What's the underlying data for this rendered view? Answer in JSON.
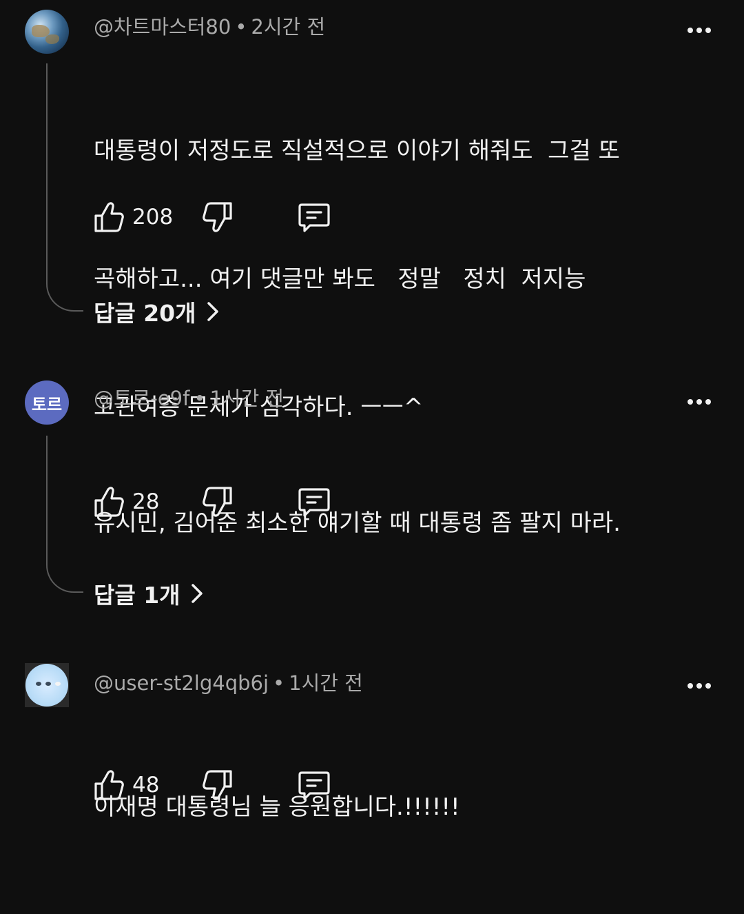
{
  "comments": [
    {
      "handle": "@차트마스터80",
      "time": "2시간 전",
      "lines": [
        "대통령이 저정도로 직설적으로 이야기 해줘도  그걸 또",
        "곡해하고... 여기 댓글만 봐도   정말   정치  저지능",
        "고관여층 문제가 심각하다. ㅡㅡ^"
      ],
      "likes": "208",
      "replies_label": "답글 20개",
      "avatar_icon": "earth-photo"
    },
    {
      "handle": "@토르-e9f",
      "time": "1시간 전",
      "avatar_text": "토르",
      "lines": [
        "유시민, 김어준 최소한 얘기할 때 대통령 좀 팔지 마라."
      ],
      "likes": "28",
      "replies_label": "답글 1개"
    },
    {
      "handle": "@user-st2lg4qb6j",
      "time": "1시간 전",
      "lines": [
        "이재명 대통령님 늘 응원합니다.!!!!!!"
      ],
      "likes": "48",
      "avatar_icon": "birds-on-water-photo"
    }
  ],
  "icons": {
    "like": "thumbs-up-icon",
    "dislike": "thumbs-down-icon",
    "reply": "comment-icon",
    "more": "more-vertical-icon",
    "expand": "chevron-right-icon"
  },
  "colors": {
    "background": "#0f0f0f",
    "text": "#f1f1f1",
    "meta": "#aaaaaa",
    "avatar_accent": "#5c6bc0"
  }
}
